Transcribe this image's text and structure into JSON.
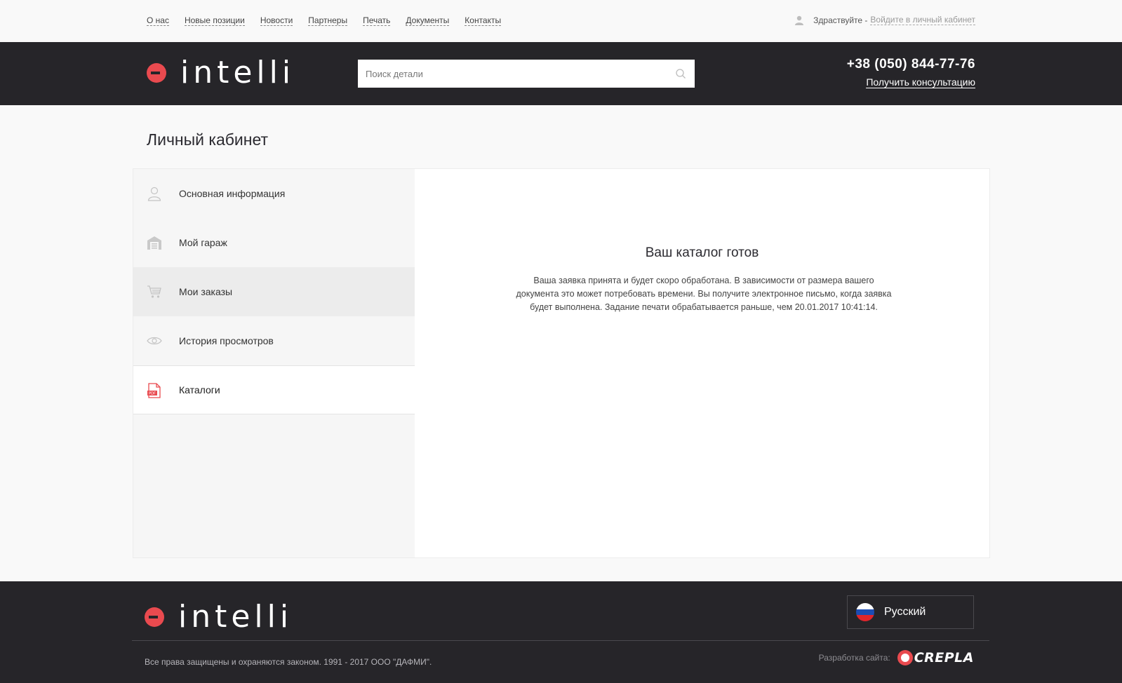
{
  "topnav": {
    "items": [
      {
        "label": "О нас"
      },
      {
        "label": "Новые позиции"
      },
      {
        "label": "Новости"
      },
      {
        "label": "Партнеры"
      },
      {
        "label": "Печать"
      },
      {
        "label": "Документы"
      },
      {
        "label": "Контакты"
      }
    ],
    "greeting": "Здраствуйте -",
    "login_link": "Войдите в личный кабинет",
    "user_icon": "user-icon"
  },
  "header": {
    "logo_text": "intelli",
    "search_placeholder": "Поиск детали",
    "search_icon": "search-icon",
    "phone": "+38 (050) 844-77-76",
    "consult_link": "Получить консультацию"
  },
  "page_title": "Личный кабинет",
  "sidebar": {
    "items": [
      {
        "label": "Основная информация",
        "icon": "user-icon",
        "state": "normal"
      },
      {
        "label": "Мой гараж",
        "icon": "garage-icon",
        "state": "normal"
      },
      {
        "label": "Мои заказы",
        "icon": "cart-icon",
        "state": "hover"
      },
      {
        "label": "История просмотров",
        "icon": "eye-icon",
        "state": "normal"
      },
      {
        "label": "Каталоги",
        "icon": "pdf-icon",
        "state": "active"
      }
    ]
  },
  "content": {
    "title": "Ваш каталог готов",
    "text": "Ваша заявка принята и будет скоро обработана. В зависимости от размера вашего документа это может потребовать времени. Вы получите электронное письмо, когда заявка будет выполнена. Задание печати обрабатывается раньше, чем 20.01.2017 10:41:14."
  },
  "footer": {
    "logo_text": "intelli",
    "language": "Русский",
    "copyright": "Все права защищены и охраняются законом. 1991 - 2017 ООО \"ДАФМИ\".",
    "dev_label": "Разработка сайта:",
    "dev_brand": "CREPLA"
  },
  "colors": {
    "accent": "#e94a4f",
    "dark": "#262529",
    "background": "#f9f9f9"
  }
}
